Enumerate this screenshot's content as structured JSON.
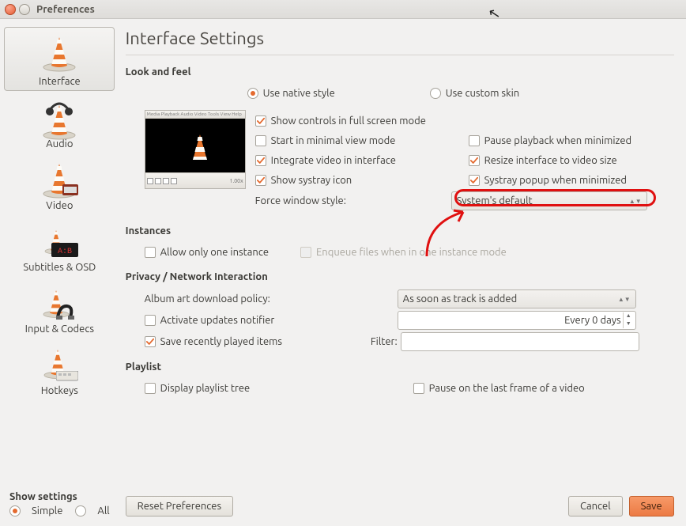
{
  "window": {
    "title": "Preferences"
  },
  "sidebar": {
    "items": [
      {
        "label": "Interface"
      },
      {
        "label": "Audio"
      },
      {
        "label": "Video"
      },
      {
        "label": "Subtitles & OSD"
      },
      {
        "label": "Input & Codecs"
      },
      {
        "label": "Hotkeys"
      }
    ]
  },
  "show_settings": {
    "title": "Show settings",
    "simple": "Simple",
    "all": "All"
  },
  "content": {
    "heading": "Interface Settings",
    "look_feel": {
      "title": "Look and feel",
      "native": "Use native style",
      "custom": "Use custom skin",
      "c0": "Show controls in full screen mode",
      "c1": "Start in minimal view mode",
      "c1b": "Pause playback when minimized",
      "c2": "Integrate video in interface",
      "c2b": "Resize interface to video size",
      "c3": "Show systray icon",
      "c3b": "Systray popup when minimized",
      "force_label": "Force window style:",
      "force_value": "System's default"
    },
    "instances": {
      "title": "Instances",
      "only_one": "Allow only one instance",
      "enqueue": "Enqueue files when in one instance mode"
    },
    "privacy": {
      "title": "Privacy / Network Interaction",
      "album_label": "Album art download policy:",
      "album_value": "As soon as track is added",
      "updates": "Activate updates notifier",
      "updates_value": "Every 0 days",
      "save_recent": "Save recently played items",
      "filter_label": "Filter:",
      "filter_value": ""
    },
    "playlist": {
      "title": "Playlist",
      "tree": "Display playlist tree",
      "pause_last": "Pause on the last frame of a video"
    }
  },
  "buttons": {
    "reset": "Reset Preferences",
    "cancel": "Cancel",
    "save": "Save"
  }
}
